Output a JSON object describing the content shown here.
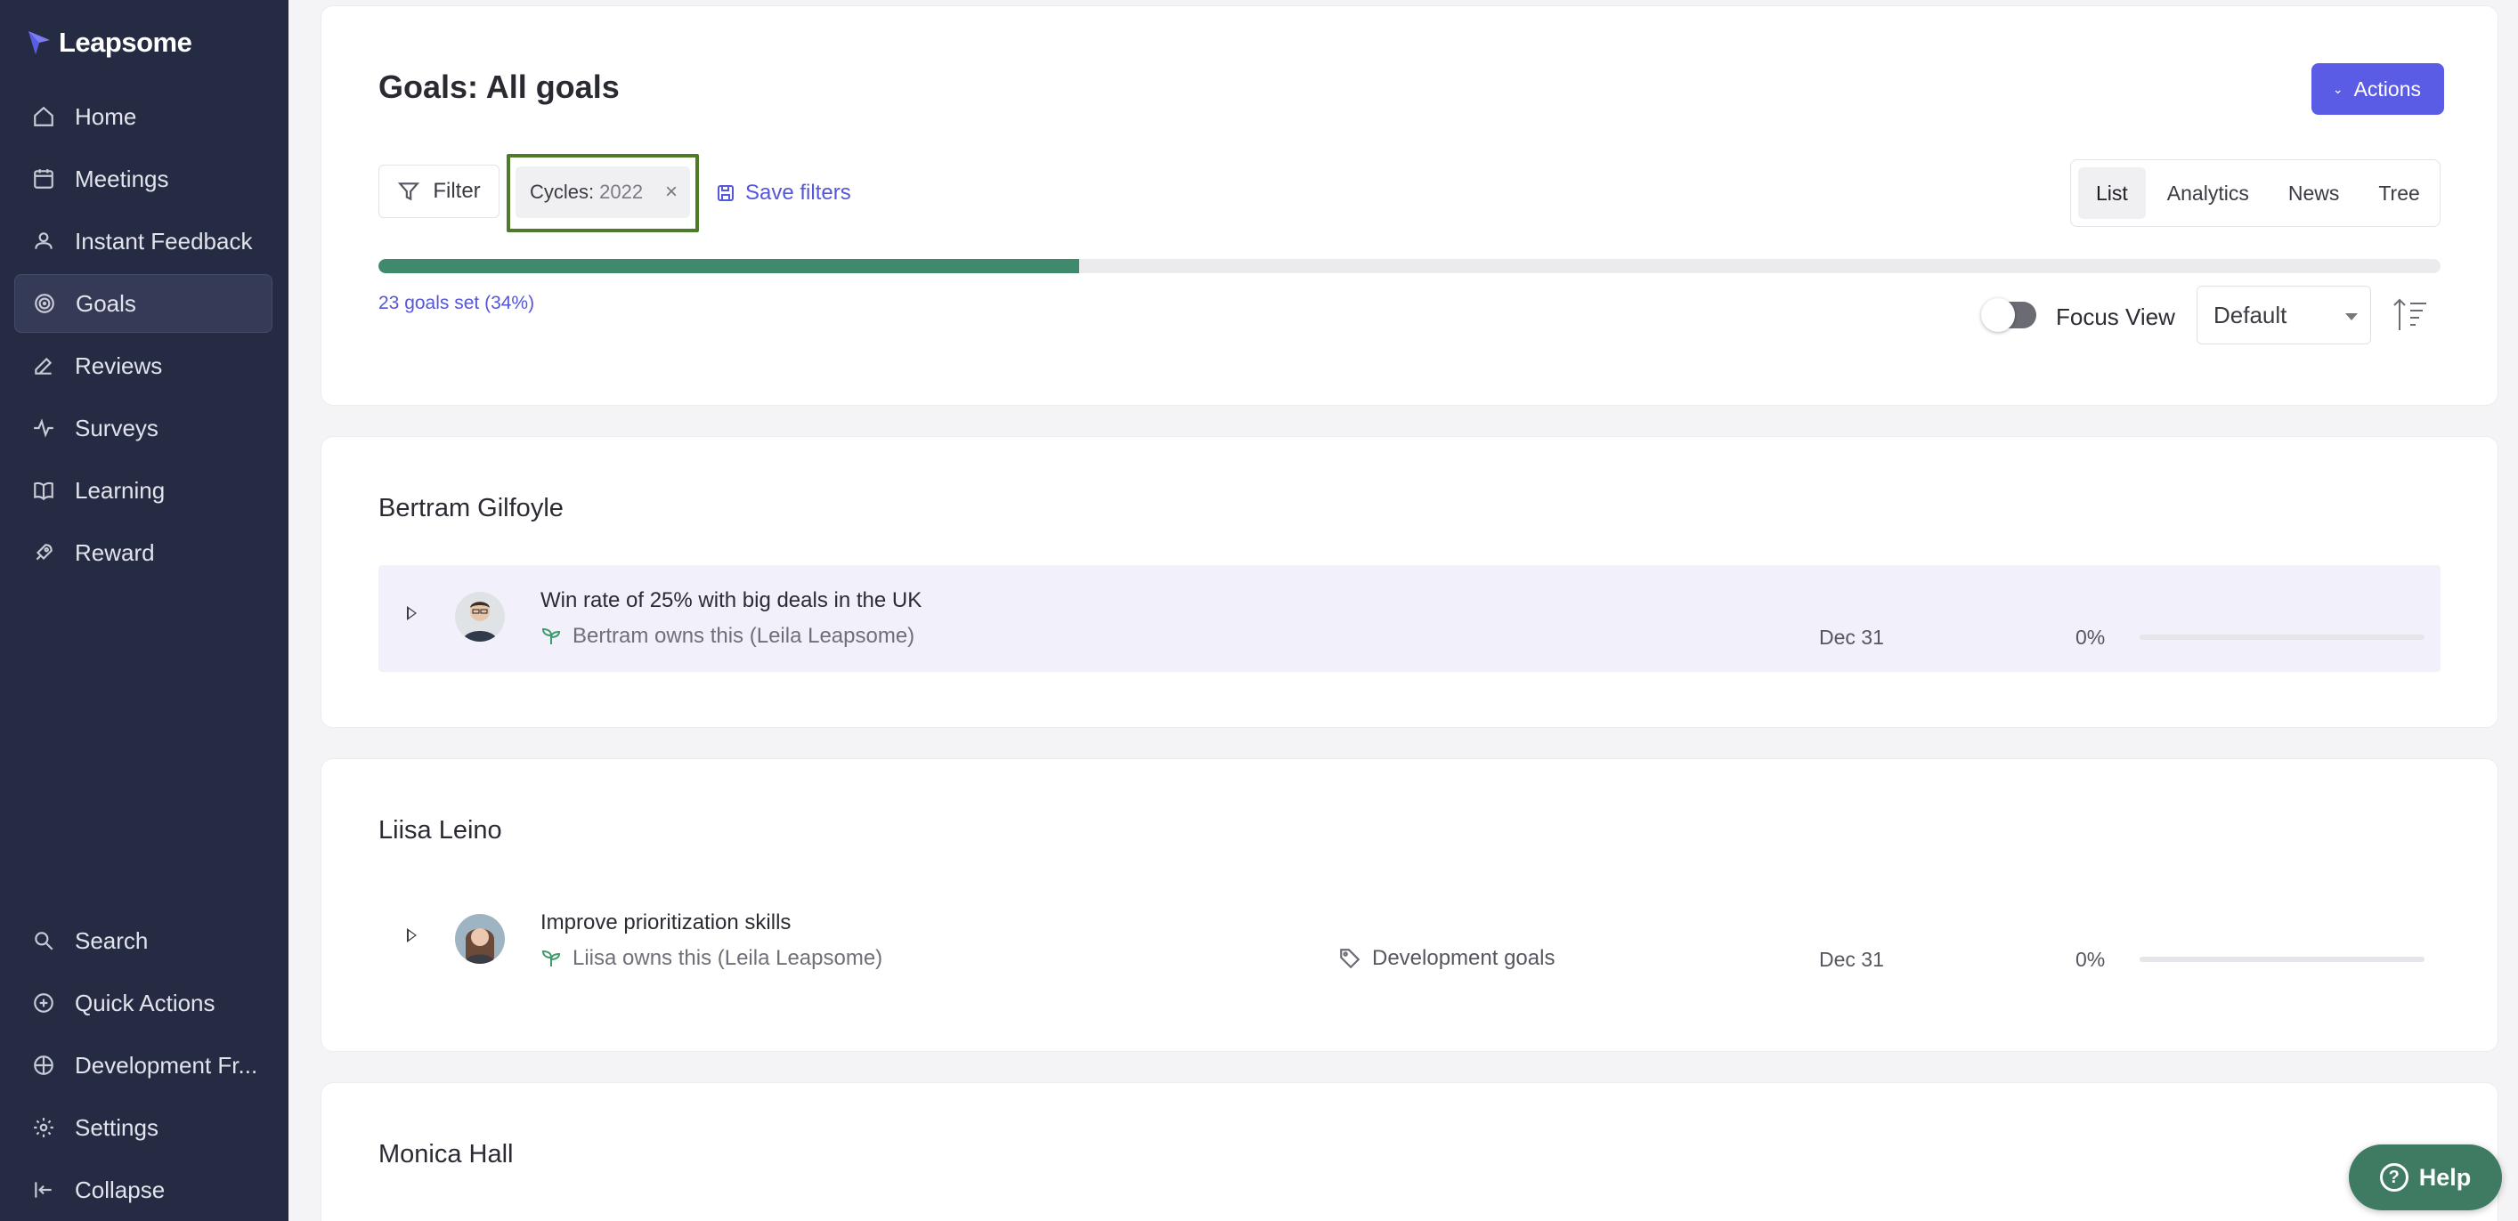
{
  "app": {
    "name": "Leapsome"
  },
  "sidebar": {
    "items": [
      {
        "label": "Home",
        "icon": "home-icon"
      },
      {
        "label": "Meetings",
        "icon": "calendar-icon"
      },
      {
        "label": "Instant Feedback",
        "icon": "feedback-icon"
      },
      {
        "label": "Goals",
        "icon": "target-icon",
        "active": true
      },
      {
        "label": "Reviews",
        "icon": "edit-icon"
      },
      {
        "label": "Surveys",
        "icon": "pulse-icon"
      },
      {
        "label": "Learning",
        "icon": "book-icon"
      },
      {
        "label": "Reward",
        "icon": "rocket-icon"
      }
    ],
    "bottom_items": [
      {
        "label": "Search",
        "icon": "search-icon"
      },
      {
        "label": "Quick Actions",
        "icon": "plus-circle-icon"
      },
      {
        "label": "Development Fr...",
        "icon": "framework-icon"
      },
      {
        "label": "Settings",
        "icon": "gear-icon"
      },
      {
        "label": "Collapse",
        "icon": "collapse-icon"
      }
    ]
  },
  "header": {
    "title": "Goals: All goals",
    "actions_label": "Actions"
  },
  "filters": {
    "filter_label": "Filter",
    "chip_key": "Cycles:",
    "chip_value": "2022",
    "save_label": "Save filters"
  },
  "view_tabs": [
    {
      "label": "List",
      "active": true
    },
    {
      "label": "Analytics"
    },
    {
      "label": "News"
    },
    {
      "label": "Tree"
    }
  ],
  "progress": {
    "fraction": 0.34,
    "label": "23 goals set (34%)"
  },
  "focus_view": {
    "label": "Focus View",
    "enabled": false
  },
  "sort_select": {
    "value": "Default"
  },
  "groups": [
    {
      "name": "Bertram Gilfoyle",
      "goals": [
        {
          "title": "Win rate of 25% with big deals in the UK",
          "owner": "Bertram owns this (Leila Leapsome)",
          "tag": "",
          "due": "Dec 31",
          "progress": "0%"
        }
      ]
    },
    {
      "name": "Liisa Leino",
      "goals": [
        {
          "title": "Improve prioritization skills",
          "owner": "Liisa owns this (Leila Leapsome)",
          "tag": "Development goals",
          "due": "Dec 31",
          "progress": "0%"
        }
      ]
    },
    {
      "name": "Monica Hall",
      "goals": []
    }
  ],
  "help": {
    "label": "Help"
  },
  "colors": {
    "sidebar": "#262b44",
    "accent": "#5b5ce6",
    "progress": "#3f8a6c",
    "help": "#3f7b62"
  }
}
